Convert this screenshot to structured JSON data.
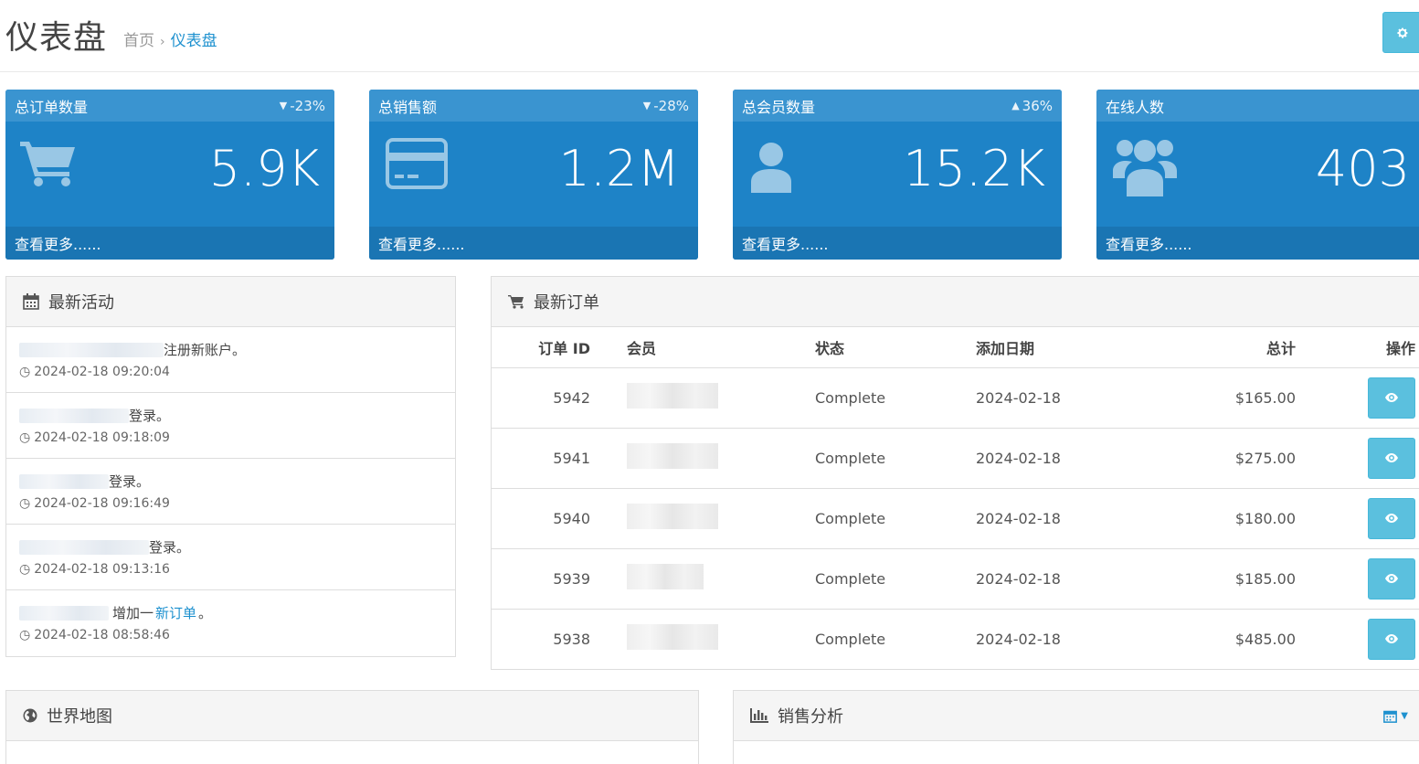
{
  "header": {
    "title": "仪表盘",
    "breadcrumb": [
      {
        "label": "首页"
      },
      {
        "label": "仪表盘"
      }
    ],
    "settings_icon": "gear-icon"
  },
  "tiles": [
    {
      "title": "总订单数量",
      "trend_dir": "down",
      "trend": "-23%",
      "value": "5.9K",
      "footer": "查看更多......",
      "icon": "shopping-cart-icon"
    },
    {
      "title": "总销售额",
      "trend_dir": "down",
      "trend": "-28%",
      "value": "1.2M",
      "footer": "查看更多......",
      "icon": "credit-card-icon"
    },
    {
      "title": "总会员数量",
      "trend_dir": "up",
      "trend": "36%",
      "value": "15.2K",
      "footer": "查看更多......",
      "icon": "user-icon"
    },
    {
      "title": "在线人数",
      "trend_dir": "",
      "trend": "",
      "value": "403",
      "footer": "查看更多......",
      "icon": "users-icon"
    }
  ],
  "activity": {
    "title": "最新活动",
    "items": [
      {
        "text": "注册新账户。",
        "time": "2024-02-18 09:20:04"
      },
      {
        "text": "登录。",
        "time": "2024-02-18 09:18:09"
      },
      {
        "text": "登录。",
        "time": "2024-02-18 09:16:49"
      },
      {
        "text": "登录。",
        "time": "2024-02-18 09:13:16"
      },
      {
        "text": "增加一",
        "link": "新订单",
        "suffix": "。",
        "time": "2024-02-18 08:58:46"
      }
    ]
  },
  "orders": {
    "title": "最新订单",
    "columns": {
      "id": "订单 ID",
      "member": "会员",
      "status": "状态",
      "date": "添加日期",
      "total": "总计",
      "action": "操作"
    },
    "rows": [
      {
        "id": "5942",
        "status": "Complete",
        "date": "2024-02-18",
        "total": "$165.00"
      },
      {
        "id": "5941",
        "status": "Complete",
        "date": "2024-02-18",
        "total": "$275.00"
      },
      {
        "id": "5940",
        "status": "Complete",
        "date": "2024-02-18",
        "total": "$180.00"
      },
      {
        "id": "5939",
        "status": "Complete",
        "date": "2024-02-18",
        "total": "$185.00"
      },
      {
        "id": "5938",
        "status": "Complete",
        "date": "2024-02-18",
        "total": "$485.00"
      }
    ]
  },
  "map_panel": {
    "title": "世界地图"
  },
  "sales_panel": {
    "title": "销售分析"
  },
  "colors": {
    "primary": "#1e83c7",
    "header": "#3a94d0",
    "footer": "#1a75b3",
    "info": "#5bc0de",
    "link": "#1e91cf"
  }
}
